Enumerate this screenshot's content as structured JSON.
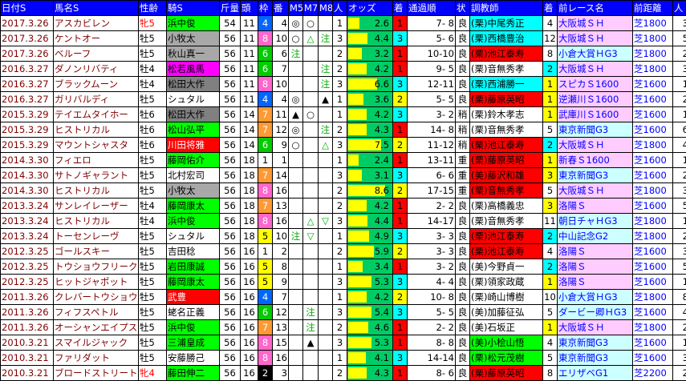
{
  "headers": [
    "日付S",
    "馬名S",
    "性齢",
    "騎S",
    "斤量",
    "頭",
    "枠",
    "番",
    "M5",
    "M7",
    "M8",
    "人",
    "オッズ",
    "着",
    "通過順",
    "状",
    "調教師",
    "着",
    "前レース名",
    "前距離",
    "人"
  ],
  "rows": [
    {
      "date": "2017.3.26",
      "horse": "アスカビレン",
      "sexage": "牝5",
      "jockey": "浜中俊",
      "weight": "54",
      "runners": "11",
      "gate": "4",
      "num": "4",
      "m5": "◎",
      "m7": "○",
      "m8": "",
      "pop": "1",
      "odds": "2.6",
      "finish": "1",
      "passing": "7- 8",
      "cond": "良",
      "trainer": "(栗)中尾秀正",
      "prev_finish": "4",
      "prev_race": "大阪城ＳＨ",
      "prev_dist": "芝1800",
      "prev_pop": "3"
    },
    {
      "date": "2017.3.26",
      "horse": "ケントオー",
      "sexage": "牡5",
      "jockey": "小牧太",
      "weight": "56",
      "runners": "11",
      "gate": "8",
      "num": "10",
      "m5": "○",
      "m7": "△",
      "m8": "注",
      "pop": "3",
      "odds": "4.4",
      "finish": "3",
      "passing": "5- 6",
      "cond": "良",
      "trainer": "(栗)西橋豊治",
      "prev_finish": "12",
      "prev_race": "大阪城ＳＨ",
      "prev_dist": "芝1800",
      "prev_pop": "5"
    },
    {
      "date": "2017.3.26",
      "horse": "ベルーフ",
      "sexage": "牡5",
      "jockey": "秋山真一",
      "weight": "56",
      "runners": "11",
      "gate": "6",
      "num": "6",
      "m5": "注",
      "m7": "",
      "m8": "",
      "pop": "2",
      "odds": "3.2",
      "finish": "1",
      "passing": "10-10",
      "cond": "良",
      "trainer": "(栗)池江泰寿",
      "prev_finish": "8",
      "prev_race": "小倉大賞ＨG3",
      "prev_dist": "芝1800",
      "prev_pop": "2"
    },
    {
      "date": "2016.3.27",
      "horse": "ダノンリバティ",
      "sexage": "牡4",
      "jockey": "松若風馬",
      "weight": "56",
      "runners": "11",
      "gate": "6",
      "num": "7",
      "m5": "",
      "m7": "",
      "m8": "注",
      "pop": "2",
      "odds": "4.2",
      "finish": "1",
      "passing": "9- 5",
      "cond": "良",
      "trainer": "(栗)音無秀孝",
      "prev_finish": "2",
      "prev_race": "大阪城ＳＨ",
      "prev_dist": "芝1800",
      "prev_pop": "3"
    },
    {
      "date": "2016.3.27",
      "horse": "ブラックムーン",
      "sexage": "牡4",
      "jockey": "松田大作",
      "weight": "56",
      "runners": "11",
      "gate": "8",
      "num": "10",
      "m5": "",
      "m7": "",
      "m8": "注",
      "pop": "3",
      "odds": "6.6",
      "finish": "3",
      "passing": "12-11",
      "cond": "良",
      "trainer": "(栗)西浦勝一",
      "prev_finish": "1",
      "prev_race": "スピカＳ1600",
      "prev_dist": "芝1600",
      "prev_pop": "1"
    },
    {
      "date": "2016.3.27",
      "horse": "ガリバルディ",
      "sexage": "牡5",
      "jockey": "シュタル",
      "weight": "56",
      "runners": "11",
      "gate": "4",
      "num": "4",
      "m5": "◎",
      "m7": "",
      "m8": "▲",
      "pop": "1",
      "odds": "3.6",
      "finish": "2",
      "passing": "5- 5",
      "cond": "良",
      "trainer": "(栗)藤原英昭",
      "prev_finish": "1",
      "prev_race": "逆瀬川Ｓ1600",
      "prev_dist": "芝1600",
      "prev_pop": "2"
    },
    {
      "date": "2015.3.29",
      "horse": "テイエムタイホー",
      "sexage": "牡6",
      "jockey": "松田大作",
      "weight": "56",
      "runners": "14",
      "gate": "7",
      "num": "11",
      "m5": "▲",
      "m7": "○",
      "m8": "",
      "pop": "1",
      "odds": "4.2",
      "finish": "3",
      "passing": "3- 2",
      "cond": "稍",
      "trainer": "(栗)鈴木孝志",
      "prev_finish": "1",
      "prev_race": "武庫川Ｓ1600",
      "prev_dist": "芝1600",
      "prev_pop": "1"
    },
    {
      "date": "2015.3.29",
      "horse": "ヒストリカル",
      "sexage": "牡6",
      "jockey": "松山弘平",
      "weight": "56",
      "runners": "14",
      "gate": "7",
      "num": "12",
      "m5": "◎",
      "m7": "",
      "m8": "注",
      "pop": "2",
      "odds": "4.3",
      "finish": "1",
      "passing": "14- 8",
      "cond": "稍",
      "trainer": "(栗)音無秀孝",
      "prev_finish": "5",
      "prev_race": "東京新聞G3",
      "prev_dist": "芝1600",
      "prev_pop": "6"
    },
    {
      "date": "2015.3.29",
      "horse": "マウントシャスタ",
      "sexage": "牡6",
      "jockey": "川田将雅",
      "weight": "56",
      "runners": "14",
      "gate": "6",
      "num": "9",
      "m5": "○",
      "m7": "",
      "m8": "△",
      "pop": "3",
      "odds": "7.5",
      "finish": "2",
      "passing": "11-12",
      "cond": "稍",
      "trainer": "(栗)池江泰寿",
      "prev_finish": "2",
      "prev_race": "大阪城ＳＨ",
      "prev_dist": "芝1800",
      "prev_pop": "4"
    },
    {
      "date": "2014.3.30",
      "horse": "フィエロ",
      "sexage": "牡5",
      "jockey": "藤岡佑介",
      "weight": "56",
      "runners": "18",
      "gate": "1",
      "num": "1",
      "m5": "",
      "m7": "",
      "m8": "",
      "pop": "1",
      "odds": "2.4",
      "finish": "1",
      "passing": "13-11",
      "cond": "重",
      "trainer": "(栗)藤原英昭",
      "prev_finish": "1",
      "prev_race": "新春Ｓ1600",
      "prev_dist": "芝1600",
      "prev_pop": "1"
    },
    {
      "date": "2014.3.30",
      "horse": "サトノギャラント",
      "sexage": "牡5",
      "jockey": "北村宏司",
      "weight": "56",
      "runners": "18",
      "gate": "7",
      "num": "14",
      "m5": "",
      "m7": "",
      "m8": "",
      "pop": "3",
      "odds": "3.1",
      "finish": "3",
      "passing": "6- 6",
      "cond": "重",
      "trainer": "(美)藤沢和雄",
      "prev_finish": "3",
      "prev_race": "東京新聞G3",
      "prev_dist": "芝1600",
      "prev_pop": "2"
    },
    {
      "date": "2014.3.30",
      "horse": "ヒストリカル",
      "sexage": "牡5",
      "jockey": "小牧太",
      "weight": "56",
      "runners": "18",
      "gate": "8",
      "num": "16",
      "m5": "",
      "m7": "",
      "m8": "",
      "pop": "2",
      "odds": "8.6",
      "finish": "2",
      "passing": "17-15",
      "cond": "重",
      "trainer": "(栗)音無秀孝",
      "prev_finish": "5",
      "prev_race": "大阪城ＳＨ",
      "prev_dist": "芝1800",
      "prev_pop": "3"
    },
    {
      "date": "2013.3.24",
      "horse": "サンレイレーザー",
      "sexage": "牡4",
      "jockey": "藤岡康太",
      "weight": "56",
      "runners": "18",
      "gate": "7",
      "num": "13",
      "m5": "",
      "m7": "",
      "m8": "",
      "pop": "2",
      "odds": "4.2",
      "finish": "1",
      "passing": "2- 2",
      "cond": "良",
      "trainer": "(栗)高橋義忠",
      "prev_finish": "3",
      "prev_race": "洛陽Ｓ",
      "prev_dist": "芝1600",
      "prev_pop": "5"
    },
    {
      "date": "2013.3.24",
      "horse": "ヒストリカル",
      "sexage": "牡4",
      "jockey": "浜中俊",
      "weight": "56",
      "runners": "18",
      "gate": "8",
      "num": "16",
      "m5": "",
      "m7": "△",
      "m8": "▽",
      "pop": "3",
      "odds": "4.4",
      "finish": "1",
      "passing": "14-17",
      "cond": "良",
      "trainer": "(栗)音無秀孝",
      "prev_finish": "11",
      "prev_race": "朝日チャＨG3",
      "prev_dist": "芝1800",
      "prev_pop": "1"
    },
    {
      "date": "2013.3.24",
      "horse": "トーセンレーヴ",
      "sexage": "牡5",
      "jockey": "シュタル",
      "weight": "56",
      "runners": "18",
      "gate": "5",
      "num": "10",
      "m5": "注",
      "m7": "▽",
      "m8": "",
      "pop": "1",
      "odds": "4.9",
      "finish": "3",
      "passing": "3- 3",
      "cond": "良",
      "trainer": "(栗)池江泰寿",
      "prev_finish": "2",
      "prev_race": "中山記念G2",
      "prev_dist": "芝1800",
      "prev_pop": "2"
    },
    {
      "date": "2012.3.25",
      "horse": "ゴールスキー",
      "sexage": "牡5",
      "jockey": "吉田稔",
      "weight": "56",
      "runners": "16",
      "gate": "1",
      "num": "2",
      "m5": "",
      "m7": "",
      "m8": "",
      "pop": "2",
      "odds": "5.9",
      "finish": "2",
      "passing": "3- 3",
      "cond": "良",
      "trainer": "(栗)池江泰寿",
      "prev_finish": "4",
      "prev_race": "洛陽Ｓ",
      "prev_dist": "芝1600",
      "prev_pop": "3"
    },
    {
      "date": "2012.3.25",
      "horse": "トウショウフリーク",
      "sexage": "牡5",
      "jockey": "岩田康誠",
      "weight": "56",
      "runners": "16",
      "gate": "5",
      "num": "8",
      "m5": "",
      "m7": "",
      "m8": "",
      "pop": "1",
      "odds": "3.4",
      "finish": "1",
      "passing": "3- 2",
      "cond": "良",
      "trainer": "(美)今野貞一",
      "prev_finish": "2",
      "prev_race": "洛陽Ｓ",
      "prev_dist": "芝1600",
      "prev_pop": "5"
    },
    {
      "date": "2012.3.25",
      "horse": "ヒットジャポット",
      "sexage": "牡5",
      "jockey": "藤岡康太",
      "weight": "56",
      "runners": "16",
      "gate": "5",
      "num": "9",
      "m5": "",
      "m7": "",
      "m8": "",
      "pop": "3",
      "odds": "5.3",
      "finish": "3",
      "passing": "4- 4",
      "cond": "良",
      "trainer": "(栗)領家政蔵",
      "prev_finish": "1",
      "prev_race": "洛陽Ｓ",
      "prev_dist": "芝1600",
      "prev_pop": "1"
    },
    {
      "date": "2011.3.26",
      "horse": "クレバートウショウ",
      "sexage": "牡5",
      "jockey": "武豊",
      "weight": "56",
      "runners": "16",
      "gate": "4",
      "num": "7",
      "m5": "",
      "m7": "",
      "m8": "",
      "pop": "1",
      "odds": "4.2",
      "finish": "2",
      "passing": "10- 8",
      "cond": "良",
      "trainer": "(栗)崎山博樹",
      "prev_finish": "10",
      "prev_race": "小倉大賞ＨG3",
      "prev_dist": "芝1800",
      "prev_pop": "8"
    },
    {
      "date": "2011.3.26",
      "horse": "フィフスペトル",
      "sexage": "牡5",
      "jockey": "蛯名正義",
      "weight": "56",
      "runners": "16",
      "gate": "6",
      "num": "12",
      "m5": "",
      "m7": "注",
      "m8": "",
      "pop": "3",
      "odds": "5.4",
      "finish": "3",
      "passing": "5- 5",
      "cond": "良",
      "trainer": "(美)加藤征弘",
      "prev_finish": "5",
      "prev_race": "ダービー卿ＨG3",
      "prev_dist": "芝1600",
      "prev_pop": "4"
    },
    {
      "date": "2011.3.26",
      "horse": "オーシャンエイプス",
      "sexage": "牡5",
      "jockey": "浜中俊",
      "weight": "56",
      "runners": "16",
      "gate": "7",
      "num": "13",
      "m5": "",
      "m7": "注",
      "m8": "",
      "pop": "2",
      "odds": "4.6",
      "finish": "1",
      "passing": "2- 2",
      "cond": "良",
      "trainer": "(美)石坂正",
      "prev_finish": "1",
      "prev_race": "大阪城ＳＨ",
      "prev_dist": "芝1800",
      "prev_pop": "2"
    },
    {
      "date": "2010.3.21",
      "horse": "スマイルジャック",
      "sexage": "牡5",
      "jockey": "三浦皇成",
      "weight": "56",
      "runners": "16",
      "gate": "8",
      "num": "15",
      "m5": "",
      "m7": "▲",
      "m8": "",
      "pop": "3",
      "odds": "5.3",
      "finish": "1",
      "passing": "8- 8",
      "cond": "良",
      "trainer": "(美)小桧山悟",
      "prev_finish": "4",
      "prev_race": "東京新聞G3",
      "prev_dist": "芝1600",
      "prev_pop": "1"
    },
    {
      "date": "2010.3.21",
      "horse": "ファリダット",
      "sexage": "牡5",
      "jockey": "安藤勝己",
      "weight": "56",
      "runners": "16",
      "gate": "8",
      "num": "16",
      "m5": "",
      "m7": "",
      "m8": "",
      "pop": "1",
      "odds": "4.1",
      "finish": "3",
      "passing": "14-14",
      "cond": "良",
      "trainer": "(栗)松元茂樹",
      "prev_finish": "5",
      "prev_race": "東京新聞G3",
      "prev_dist": "芝1600",
      "prev_pop": "3"
    },
    {
      "date": "2010.3.21",
      "horse": "ブロードストリート",
      "sexage": "牝4",
      "jockey": "藤田伸二",
      "weight": "56",
      "runners": "16",
      "gate": "2",
      "num": "3",
      "m5": "",
      "m7": "",
      "m8": "",
      "pop": "2",
      "odds": "4.3",
      "finish": "1",
      "passing": "8- 6",
      "cond": "良",
      "trainer": "(栗)藤原英昭",
      "prev_finish": "8",
      "prev_race": "エリザベG1",
      "prev_dist": "芝2200",
      "prev_pop": "2"
    }
  ]
}
